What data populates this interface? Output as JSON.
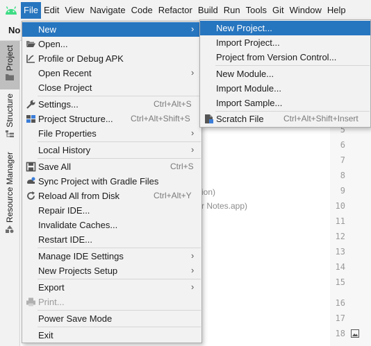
{
  "menubar": {
    "items": [
      "File",
      "Edit",
      "View",
      "Navigate",
      "Code",
      "Refactor",
      "Build",
      "Run",
      "Tools",
      "Git",
      "Window",
      "Help"
    ]
  },
  "toolbar": {
    "project_abbrev": "No"
  },
  "side_tabs": {
    "project": "Project",
    "structure": "Structure",
    "resource_manager": "Resource Manager"
  },
  "file_menu": {
    "items": [
      {
        "label": "New",
        "shortcut": "",
        "submenu": true
      },
      {
        "label": "Open...",
        "shortcut": "",
        "submenu": false
      },
      {
        "label": "Profile or Debug APK",
        "shortcut": "",
        "submenu": false
      },
      {
        "label": "Open Recent",
        "shortcut": "",
        "submenu": true
      },
      {
        "label": "Close Project",
        "shortcut": "",
        "submenu": false
      },
      {
        "label": "Settings...",
        "shortcut": "Ctrl+Alt+S",
        "submenu": false
      },
      {
        "label": "Project Structure...",
        "shortcut": "Ctrl+Alt+Shift+S",
        "submenu": false
      },
      {
        "label": "File Properties",
        "shortcut": "",
        "submenu": true
      },
      {
        "label": "Local History",
        "shortcut": "",
        "submenu": true
      },
      {
        "label": "Save All",
        "shortcut": "Ctrl+S",
        "submenu": false
      },
      {
        "label": "Sync Project with Gradle Files",
        "shortcut": "",
        "submenu": false
      },
      {
        "label": "Reload All from Disk",
        "shortcut": "Ctrl+Alt+Y",
        "submenu": false
      },
      {
        "label": "Repair IDE...",
        "shortcut": "",
        "submenu": false
      },
      {
        "label": "Invalidate Caches...",
        "shortcut": "",
        "submenu": false
      },
      {
        "label": "Restart IDE...",
        "shortcut": "",
        "submenu": false
      },
      {
        "label": "Manage IDE Settings",
        "shortcut": "",
        "submenu": true
      },
      {
        "label": "New Projects Setup",
        "shortcut": "",
        "submenu": true
      },
      {
        "label": "Export",
        "shortcut": "",
        "submenu": true
      },
      {
        "label": "Print...",
        "shortcut": "",
        "submenu": false
      },
      {
        "label": "Power Save Mode",
        "shortcut": "",
        "submenu": false
      },
      {
        "label": "Exit",
        "shortcut": "",
        "submenu": false
      }
    ]
  },
  "new_submenu": {
    "items": [
      {
        "label": "New Project...",
        "shortcut": ""
      },
      {
        "label": "Import Project...",
        "shortcut": ""
      },
      {
        "label": "Project from Version Control...",
        "shortcut": ""
      },
      {
        "label": "New Module...",
        "shortcut": ""
      },
      {
        "label": "Import Module...",
        "shortcut": ""
      },
      {
        "label": "Import Sample...",
        "shortcut": ""
      },
      {
        "label": "Scratch File",
        "shortcut": "Ctrl+Alt+Shift+Insert"
      }
    ]
  },
  "editor": {
    "line_numbers": [
      "5",
      "6",
      "7",
      "8",
      "9",
      "10",
      "11",
      "12",
      "13",
      "14",
      "15",
      "16",
      "17",
      "18"
    ],
    "fragment_1": "ion)",
    "fragment_2": "r Notes.app)"
  },
  "colors": {
    "highlight": "#2675bf",
    "menu_bg": "#f2f2f2",
    "android_green": "#3ddc84"
  }
}
